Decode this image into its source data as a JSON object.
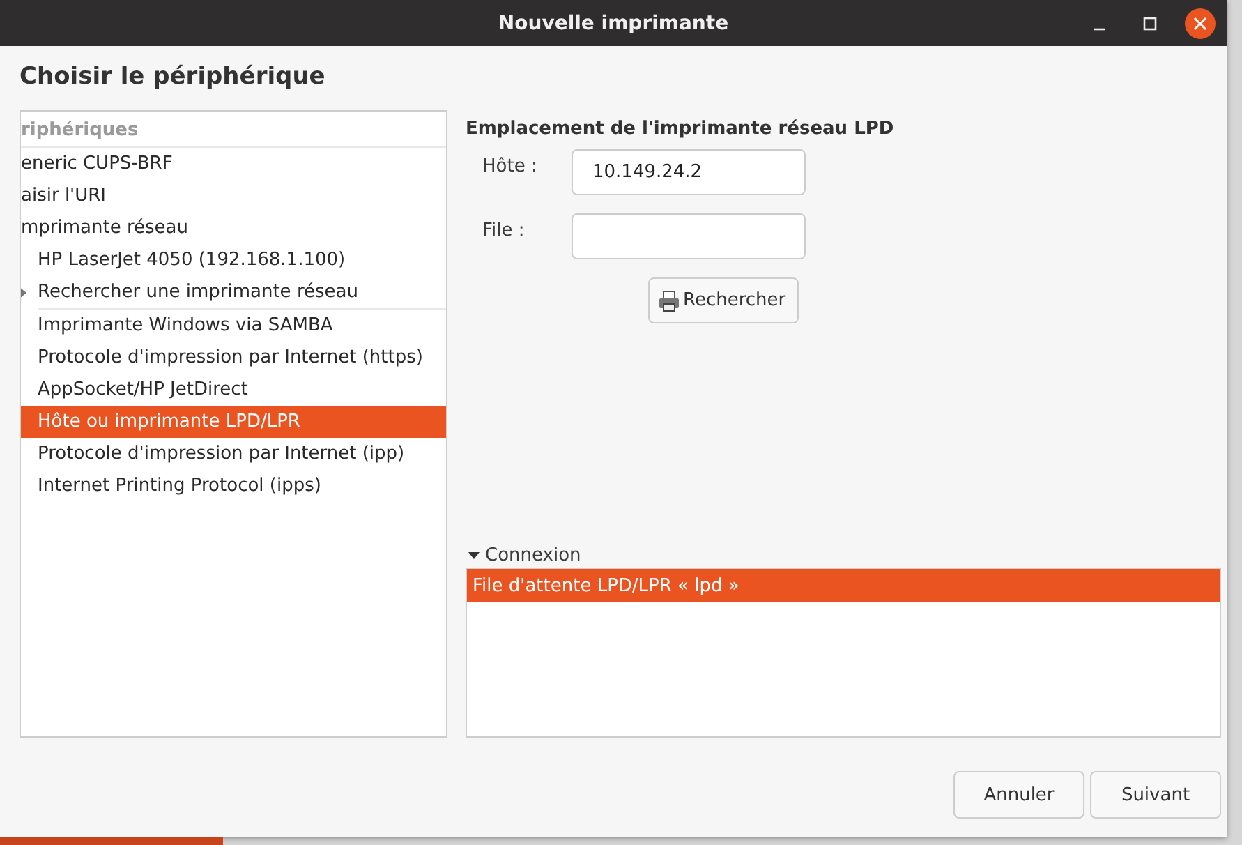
{
  "window": {
    "title": "Nouvelle imprimante"
  },
  "heading": "Choisir le périphérique",
  "device_tree": {
    "header": "riphériques",
    "items": [
      {
        "label": "eneric CUPS-BRF",
        "selected": false
      },
      {
        "label": "aisir l'URI",
        "selected": false
      },
      {
        "label": "mprimante réseau",
        "selected": false,
        "expanded": true,
        "children": [
          {
            "label": "HP LaserJet 4050 (192.168.1.100)",
            "selected": false
          },
          {
            "label": "Rechercher une imprimante réseau",
            "selected": false,
            "expanded": false
          }
        ]
      }
    ],
    "other_items": [
      {
        "label": "Imprimante Windows via SAMBA",
        "selected": false
      },
      {
        "label": "Protocole d'impression par Internet (https)",
        "selected": false
      },
      {
        "label": "AppSocket/HP JetDirect",
        "selected": false
      },
      {
        "label": "Hôte ou imprimante LPD/LPR",
        "selected": true
      },
      {
        "label": "Protocole d'impression par Internet (ipp)",
        "selected": false
      },
      {
        "label": "Internet Printing Protocol (ipps)",
        "selected": false
      }
    ]
  },
  "location": {
    "title": "Emplacement de l'imprimante réseau LPD",
    "fields": [
      {
        "label": "Hôte :",
        "value": "10.149.24.2"
      },
      {
        "label": "File :"
      }
    ],
    "search_button": "Rechercher"
  },
  "connection": {
    "label": "Connexion",
    "expanded": true,
    "items": [
      {
        "label": "File d'attente LPD/LPR « lpd »",
        "selected": true
      }
    ]
  },
  "buttons": [
    "Annuler",
    "Suivant"
  ]
}
